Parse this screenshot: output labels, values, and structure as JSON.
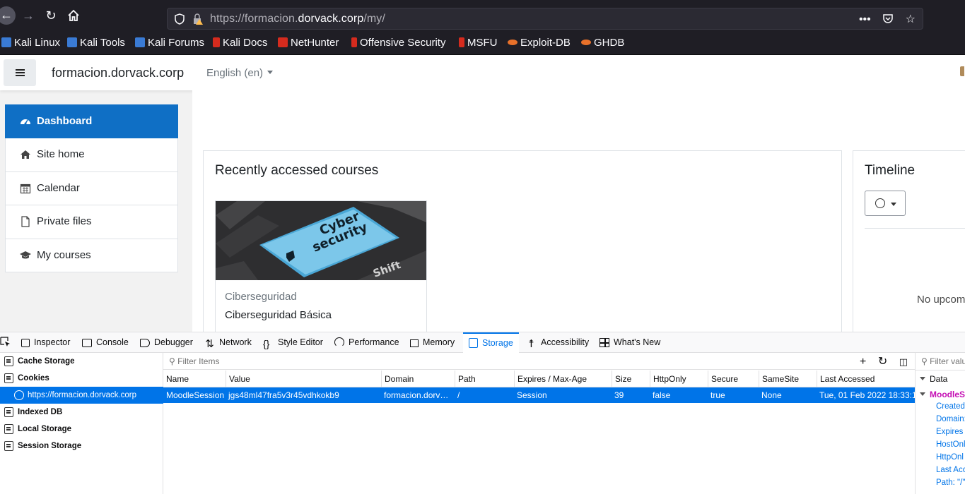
{
  "browser": {
    "url_prefix": "https://formacion.",
    "url_host": "dorvack.corp",
    "url_path": "/my/",
    "bookmarks": [
      {
        "label": "Kali Linux",
        "color": "#3a7bd5"
      },
      {
        "label": "Kali Tools",
        "color": "#3a7bd5"
      },
      {
        "label": "Kali Forums",
        "color": "#3a7bd5"
      },
      {
        "label": "Kali Docs",
        "color": "#d52b1e"
      },
      {
        "label": "NetHunter",
        "color": "#d52b1e"
      },
      {
        "label": "Offensive Security",
        "color": "#d52b1e"
      },
      {
        "label": "MSFU",
        "color": "#d52b1e"
      },
      {
        "label": "Exploit-DB",
        "color": "#e8712a"
      },
      {
        "label": "GHDB",
        "color": "#e8712a"
      }
    ]
  },
  "site": {
    "name": "formacion.dorvack.corp",
    "language": "English (en)"
  },
  "sidebar": {
    "items": [
      {
        "label": "Dashboard",
        "icon": "dashboard-icon",
        "active": true
      },
      {
        "label": "Site home",
        "icon": "home-icon"
      },
      {
        "label": "Calendar",
        "icon": "calendar-icon"
      },
      {
        "label": "Private files",
        "icon": "file-icon"
      },
      {
        "label": "My courses",
        "icon": "graduation-cap-icon"
      }
    ]
  },
  "main": {
    "recent_title": "Recently accessed courses",
    "course": {
      "category": "Ciberseguridad",
      "name": "Ciberseguridad Básica",
      "image_text_1": "Cyber",
      "image_text_2": "security",
      "image_key": "Shift"
    },
    "timeline_title": "Timeline",
    "timeline_empty": "No upcom"
  },
  "devtools": {
    "tabs": [
      "Inspector",
      "Console",
      "Debugger",
      "Network",
      "Style Editor",
      "Performance",
      "Memory",
      "Storage",
      "Accessibility",
      "What's New"
    ],
    "active_tab": "Storage",
    "tree": [
      "Cache Storage",
      "Cookies",
      "https://formacion.dorvack.corp",
      "Indexed DB",
      "Local Storage",
      "Session Storage"
    ],
    "filter_placeholder": "Filter Items",
    "columns": [
      "Name",
      "Value",
      "Domain",
      "Path",
      "Expires / Max-Age",
      "Size",
      "HttpOnly",
      "Secure",
      "SameSite",
      "Last Accessed"
    ],
    "row": [
      "MoodleSession",
      "jgs48ml47fra5v3r45vdhkokb9",
      "formacion.dorvack.corp",
      "/",
      "Session",
      "39",
      "false",
      "true",
      "None",
      "Tue, 01 Feb 2022 18:33:1"
    ],
    "sidebar_filter": "Filter valu",
    "data_header": "Data",
    "session_label": "MoodleSe",
    "props": [
      "Created:",
      "Domain:",
      "Expires /",
      "HostOnl",
      "HttpOnl",
      "Last Acc",
      "Path: \"/\""
    ]
  }
}
